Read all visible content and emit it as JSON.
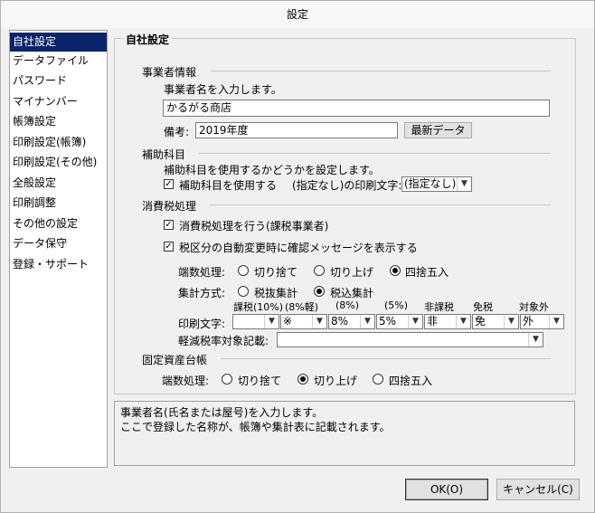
{
  "window": {
    "title": "設定"
  },
  "sidebar": {
    "items": [
      {
        "label": "自社設定",
        "selected": true
      },
      {
        "label": "データファイル"
      },
      {
        "label": "パスワード"
      },
      {
        "label": "マイナンバー"
      },
      {
        "label": "帳簿設定"
      },
      {
        "label": "印刷設定(帳簿)"
      },
      {
        "label": "印刷設定(その他)"
      },
      {
        "label": "全般設定"
      },
      {
        "label": "印刷調整"
      },
      {
        "label": "その他の設定"
      },
      {
        "label": "データ保守"
      },
      {
        "label": "登録・サポート"
      }
    ]
  },
  "main": {
    "title": "自社設定",
    "business": {
      "heading": "事業者情報",
      "description": "事業者名を入力します。",
      "name_value": "かるがる商店",
      "note_label": "備考:",
      "note_value": "2019年度",
      "latest_button": "最新データ"
    },
    "sub_account": {
      "heading": "補助科目",
      "description": "補助科目を使用するかどうかを設定します。",
      "use_checkbox_label": "補助科目を使用する",
      "use_checked": true,
      "print_char_label": "(指定なし)の印刷文字:",
      "print_char_value": "(指定なし)"
    },
    "tax": {
      "heading": "消費税処理",
      "process_label": "消費税処理を行う(課税事業者)",
      "process_checked": true,
      "confirm_label": "税区分の自動変更時に確認メッセージを表示する",
      "confirm_checked": true,
      "rounding_label": "端数処理:",
      "rounding_options": [
        "切り捨て",
        "切り上げ",
        "四捨五入"
      ],
      "rounding_selected": "四捨五入",
      "calc_label": "集計方式:",
      "calc_options": [
        "税抜集計",
        "税込集計"
      ],
      "calc_selected": "税込集計",
      "print_char_label": "印刷文字:",
      "columns": [
        {
          "header": "課税(10%)",
          "value": ""
        },
        {
          "header": "(8%軽)",
          "value": "※"
        },
        {
          "header": "(8%)",
          "value": "8%"
        },
        {
          "header": "(5%)",
          "value": "5%"
        },
        {
          "header": "非課税",
          "value": "非"
        },
        {
          "header": "免税",
          "value": "免"
        },
        {
          "header": "対象外",
          "value": "外"
        }
      ],
      "reduced_label": "軽減税率対象記載:",
      "reduced_value": ""
    },
    "fixed_assets": {
      "heading": "固定資産台帳",
      "rounding_label": "端数処理:",
      "rounding_options": [
        "切り捨て",
        "切り上げ",
        "四捨五入"
      ],
      "rounding_selected": "切り上げ"
    }
  },
  "help": {
    "line1": "事業者名(氏名または屋号)を入力します。",
    "line2": "ここで登録した名称が、帳簿や集計表に記載されます。"
  },
  "footer": {
    "ok_label": "OK(O)",
    "cancel_label": "キャンセル(C)"
  }
}
